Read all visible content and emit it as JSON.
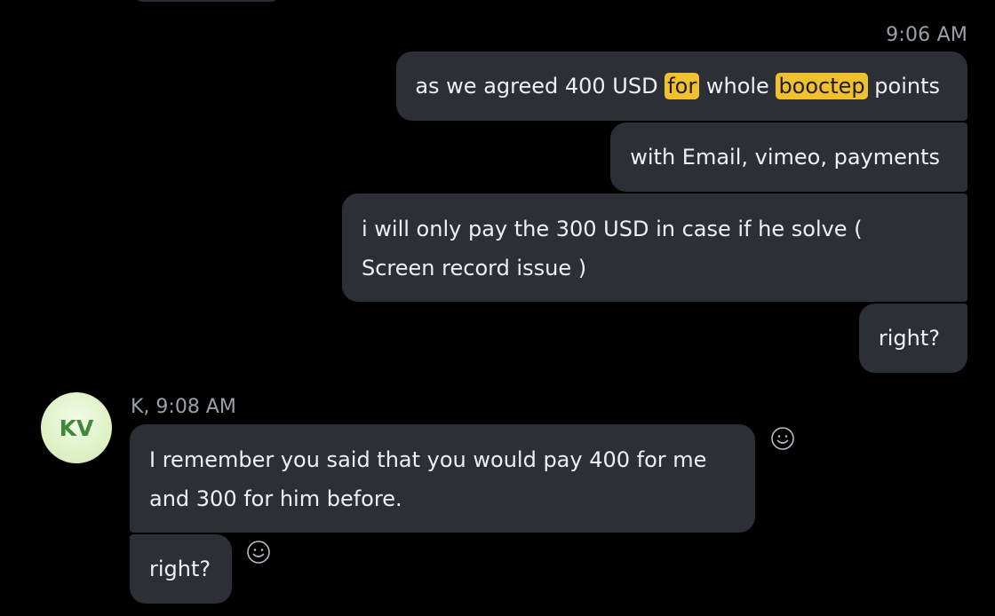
{
  "thread": {
    "outgoing_timestamp": "9:06 AM",
    "outgoing_messages": [
      {
        "segments": [
          {
            "text": "as we agreed 400 USD ",
            "highlight": false
          },
          {
            "text": "for",
            "highlight": true
          },
          {
            "text": " whole ",
            "highlight": false
          },
          {
            "text": "booctep",
            "highlight": true
          },
          {
            "text": " points",
            "highlight": false
          }
        ]
      },
      {
        "text": "with Email, vimeo, payments"
      },
      {
        "text": "i will only pay the 300 USD in case if he solve ( Screen record issue )"
      },
      {
        "text": "right?"
      }
    ],
    "incoming": {
      "avatar_initials": "KV",
      "sender_line": "K, 9:08 AM",
      "messages": [
        {
          "text": "I remember you said that you would pay 400 for me and 300 for him before."
        },
        {
          "text": "right?"
        }
      ]
    }
  },
  "icons": {
    "reaction": "smiley-face-icon"
  },
  "colors": {
    "background": "#000000",
    "bubble": "#2c2f36",
    "highlight": "#f0c02f",
    "timestamp": "#9aa0a6",
    "avatar_text": "#3f8a3a",
    "avatar_bg": "#dff1c7"
  }
}
